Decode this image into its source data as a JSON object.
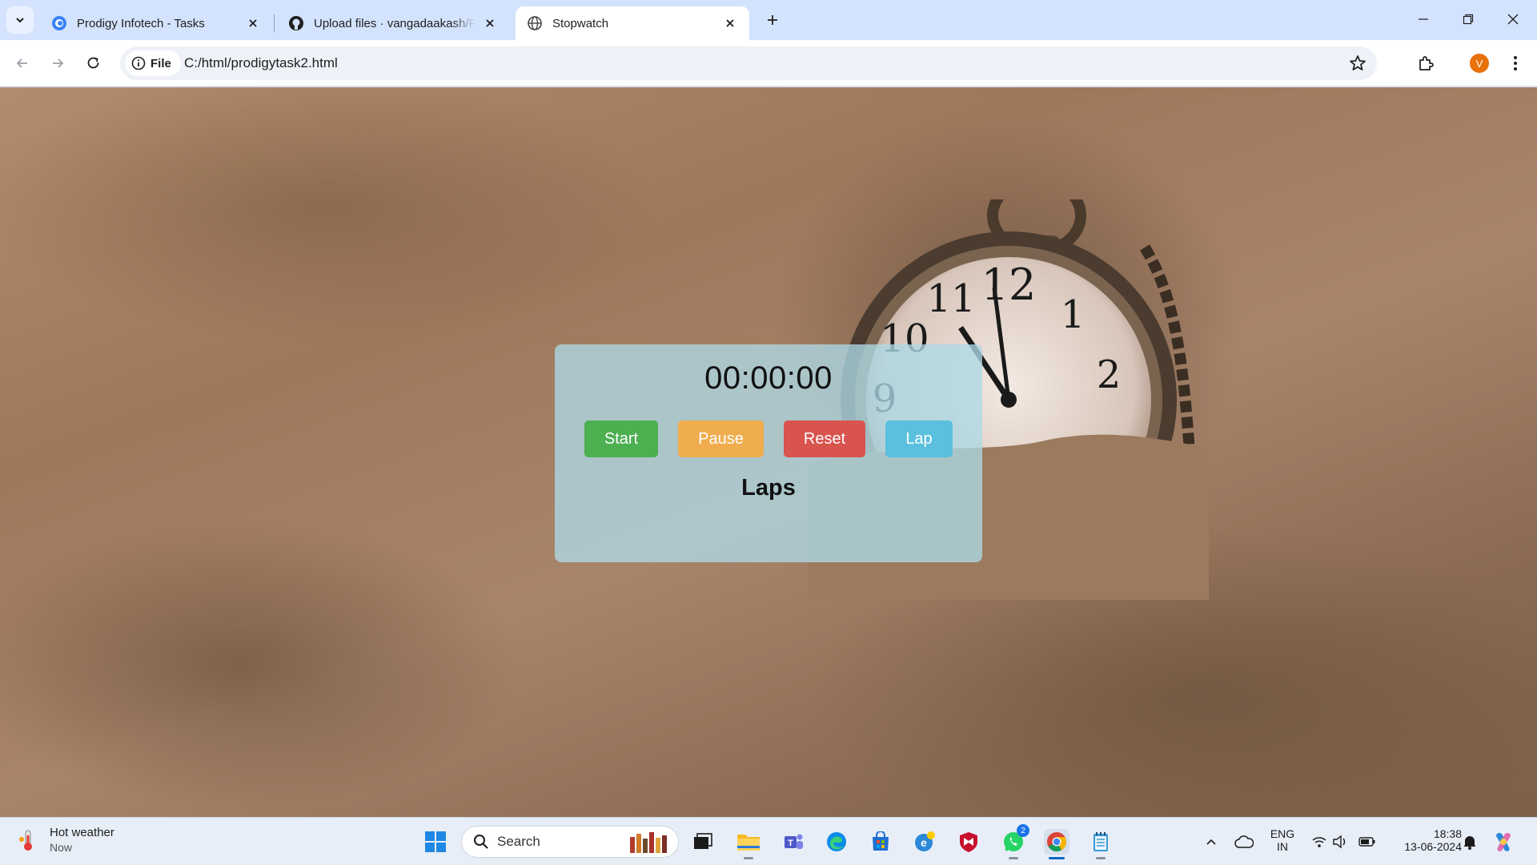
{
  "browser": {
    "tabs": [
      {
        "title": "Prodigy Infotech - Tasks",
        "icon": "prodigy-logo-icon",
        "active": false
      },
      {
        "title": "Upload files · vangadaakash/PRODIGY",
        "icon": "github-icon",
        "active": false
      },
      {
        "title": "Stopwatch",
        "icon": "globe-icon",
        "active": true
      }
    ],
    "address": {
      "chip_label": "File",
      "url": "C:/html/prodigytask2.html"
    },
    "profile_initial": "V"
  },
  "stopwatch": {
    "time": "00:00:00",
    "buttons": {
      "start": "Start",
      "pause": "Pause",
      "reset": "Reset",
      "lap": "Lap"
    },
    "laps_heading": "Laps",
    "colors": {
      "start": "#4caf50",
      "pause": "#f0ad4e",
      "reset": "#d9534f",
      "lap": "#5bc0de",
      "card": "#add8e6"
    }
  },
  "taskbar": {
    "weather": {
      "title": "Hot weather",
      "subtitle": "Now"
    },
    "search_placeholder": "Search",
    "whatsapp_badge": "2",
    "tray": {
      "language_line1": "ENG",
      "language_line2": "IN",
      "time": "18:38",
      "date": "13-06-2024"
    }
  }
}
